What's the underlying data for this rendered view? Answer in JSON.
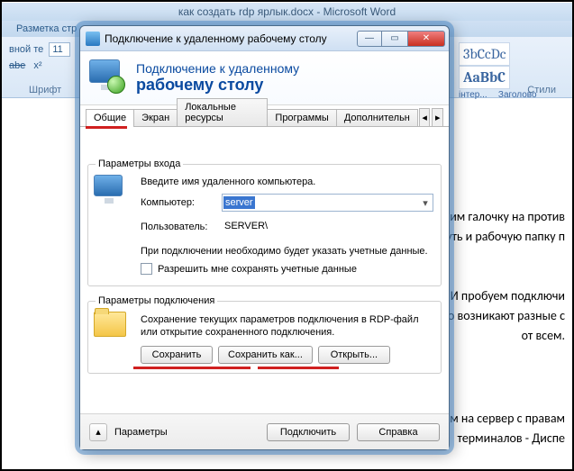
{
  "word": {
    "title": "как создать rdp ярлык.docx - Microsoft Word",
    "ribbon_tab": "Разметка стр",
    "font_size": "11",
    "font_size_label": "вной те",
    "abc": "abe",
    "x2": "x²",
    "section_font": "Шрифт",
    "style1": "3bCcDc",
    "style2": "AaBbC",
    "style1_label": "інтер...",
    "style2_label": "Заголово",
    "section_styles": "Стили",
    "doc_lines": {
      "l1": "им галочку на против",
      "l2": "уть и рабочую папку п",
      "l3": "И пробуем подключи",
      "l4": "о возникают разные с",
      "l5": "от всем.",
      "l6": "м на сервер с правам",
      "l7": "терминалов - Диспе"
    }
  },
  "dialog": {
    "title": "Подключение к удаленному рабочему столу",
    "header_line1": "Подключение к удаленному",
    "header_line2": "рабочему столу",
    "tabs": {
      "t0": "Общие",
      "t1": "Экран",
      "t2": "Локальные ресурсы",
      "t3": "Программы",
      "t4": "Дополнительн"
    },
    "login": {
      "legend": "Параметры входа",
      "intro": "Введите имя удаленного компьютера.",
      "computer_label": "Компьютер:",
      "computer_value": "server",
      "user_label": "Пользователь:",
      "user_value": "SERVER\\",
      "note": "При подключении необходимо будет указать учетные данные.",
      "checkbox": "Разрешить мне сохранять учетные данные"
    },
    "conn": {
      "legend": "Параметры подключения",
      "text": "Сохранение текущих параметров подключения в RDP-файл или открытие сохраненного подключения.",
      "save": "Сохранить",
      "saveas": "Сохранить как...",
      "open": "Открыть..."
    },
    "bottom": {
      "params": "Параметры",
      "connect": "Подключить",
      "help": "Справка"
    }
  }
}
